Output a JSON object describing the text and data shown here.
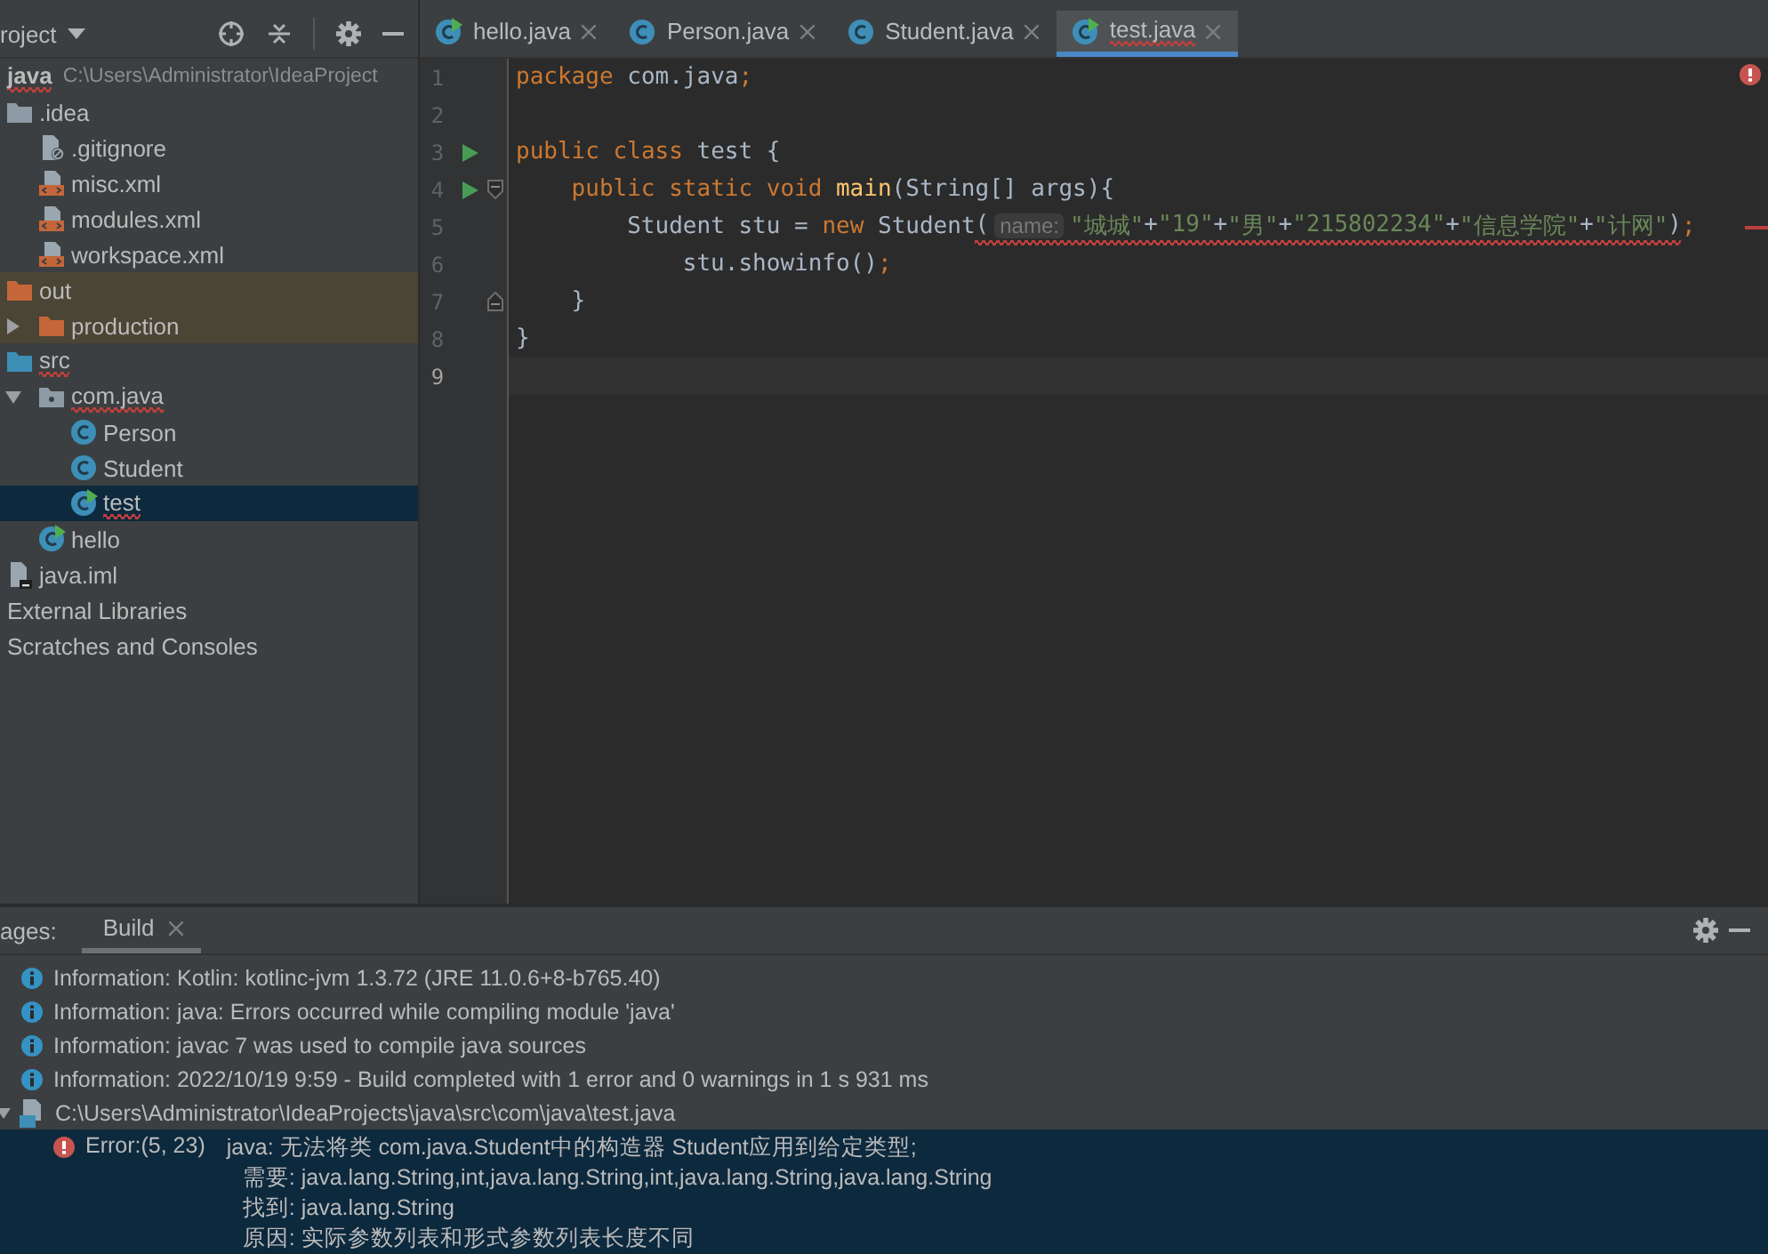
{
  "project_panel": {
    "title": "roject",
    "tree": [
      {
        "label": "java",
        "kind": "module",
        "error": true,
        "path": "C:\\Users\\Administrator\\IdeaProject",
        "selected": false,
        "children": [
          {
            "label": ".idea",
            "kind": "folder",
            "error": false,
            "selected": false,
            "children": [
              {
                "label": ".gitignore",
                "kind": "ignore-file",
                "error": false,
                "selected": false
              },
              {
                "label": "misc.xml",
                "kind": "xml-file",
                "error": false,
                "selected": false
              },
              {
                "label": "modules.xml",
                "kind": "xml-file",
                "error": false,
                "selected": false
              },
              {
                "label": "workspace.xml",
                "kind": "xml-file",
                "error": false,
                "selected": false
              }
            ]
          },
          {
            "label": "out",
            "kind": "excluded-folder",
            "error": false,
            "selected": false,
            "children": [
              {
                "label": "production",
                "kind": "excluded-folder",
                "error": false,
                "selected": false,
                "expanded": false
              }
            ]
          },
          {
            "label": "src",
            "kind": "source-folder",
            "error": true,
            "selected": false,
            "children": [
              {
                "label": "com.java",
                "kind": "package",
                "error": true,
                "selected": false,
                "expanded": true,
                "children": [
                  {
                    "label": "Person",
                    "kind": "class",
                    "error": false,
                    "selected": false
                  },
                  {
                    "label": "Student",
                    "kind": "class",
                    "error": false,
                    "selected": false
                  },
                  {
                    "label": "test",
                    "kind": "runnable-class",
                    "error": true,
                    "selected": true
                  }
                ]
              },
              {
                "label": "hello",
                "kind": "runnable-class",
                "error": false,
                "selected": false
              }
            ]
          },
          {
            "label": "java.iml",
            "kind": "module-file",
            "error": false,
            "selected": false
          }
        ]
      },
      {
        "label": "External Libraries",
        "kind": "libraries",
        "error": false,
        "selected": false
      },
      {
        "label": "Scratches and Consoles",
        "kind": "scratches",
        "error": false,
        "selected": false
      }
    ]
  },
  "editor_tabs": [
    {
      "label": "hello.java",
      "kind": "runnable-class",
      "error": false,
      "selected": false
    },
    {
      "label": "Person.java",
      "kind": "class",
      "error": false,
      "selected": false
    },
    {
      "label": "Student.java",
      "kind": "class",
      "error": false,
      "selected": false
    },
    {
      "label": "test.java",
      "kind": "runnable-class",
      "error": true,
      "selected": true
    }
  ],
  "editor": {
    "has_errors": true,
    "lines": [
      {
        "number": "1",
        "run": false,
        "fold_start": false,
        "fold_end": false,
        "current": false,
        "segments": [
          {
            "error": false,
            "tokens": [
              {
                "kind": "keyword",
                "text": "package"
              },
              {
                "kind": "plain",
                "text": " com.java"
              },
              {
                "kind": "keyword",
                "text": ";"
              }
            ]
          }
        ]
      },
      {
        "number": "2",
        "run": false,
        "fold_start": false,
        "fold_end": false,
        "current": false
      },
      {
        "number": "3",
        "run": true,
        "fold_start": false,
        "fold_end": false,
        "current": false,
        "segments": [
          {
            "error": false,
            "tokens": [
              {
                "kind": "keyword",
                "text": "public class"
              },
              {
                "kind": "plain",
                "text": " test {"
              }
            ]
          }
        ],
        "children": [
          {
            "number": "4",
            "run": true,
            "fold_start": true,
            "fold_end": false,
            "current": false,
            "segments": [
              {
                "error": false,
                "tokens": [
                  {
                    "kind": "keyword",
                    "text": "public static void"
                  },
                  {
                    "kind": "method",
                    "text": "main"
                  },
                  {
                    "kind": "plain",
                    "text": "(String[] args){"
                  }
                ]
              }
            ],
            "children": [
              {
                "number": "5",
                "run": false,
                "fold_start": false,
                "fold_end": false,
                "current": false,
                "stripe_error": true,
                "segments": [
                  {
                    "error": false,
                    "tokens": [
                      {
                        "kind": "plain",
                        "text": "Student stu = "
                      },
                      {
                        "kind": "keyword",
                        "text": "new"
                      },
                      {
                        "kind": "plain",
                        "text": " Student"
                      }
                    ]
                  },
                  {
                    "error": true,
                    "tokens": [
                      {
                        "kind": "plain",
                        "text": "("
                      },
                      {
                        "kind": "hint",
                        "text": "name:"
                      },
                      {
                        "kind": "string",
                        "text": "\"城城\""
                      },
                      {
                        "kind": "plain",
                        "text": "+"
                      },
                      {
                        "kind": "string",
                        "text": "\"19\""
                      },
                      {
                        "kind": "plain",
                        "text": "+"
                      },
                      {
                        "kind": "string",
                        "text": "\"男\""
                      },
                      {
                        "kind": "plain",
                        "text": "+"
                      },
                      {
                        "kind": "string",
                        "text": "\"215802234\""
                      },
                      {
                        "kind": "plain",
                        "text": "+"
                      },
                      {
                        "kind": "string",
                        "text": "\"信息学院\""
                      },
                      {
                        "kind": "plain",
                        "text": "+"
                      },
                      {
                        "kind": "string",
                        "text": "\"计网\""
                      },
                      {
                        "kind": "plain",
                        "text": ")"
                      }
                    ]
                  },
                  {
                    "error": false,
                    "tokens": [
                      {
                        "kind": "keyword",
                        "text": ";"
                      }
                    ]
                  }
                ],
                "children": [
                  {
                    "number": "6",
                    "run": false,
                    "fold_start": false,
                    "fold_end": false,
                    "current": false,
                    "segments": [
                      {
                        "error": false,
                        "tokens": [
                          {
                            "kind": "plain",
                            "text": "stu.showinfo()"
                          },
                          {
                            "kind": "keyword",
                            "text": ";"
                          }
                        ]
                      }
                    ]
                  }
                ]
              }
            ]
          },
          {
            "number": "7",
            "run": false,
            "fold_start": false,
            "fold_end": true,
            "current": false,
            "segments": [
              {
                "error": false,
                "tokens": [
                  {
                    "kind": "plain",
                    "text": "}"
                  }
                ]
              }
            ]
          }
        ]
      },
      {
        "number": "8",
        "run": false,
        "fold_start": false,
        "fold_end": false,
        "current": false,
        "segments": [
          {
            "error": false,
            "tokens": [
              {
                "kind": "plain",
                "text": "}"
              }
            ]
          }
        ]
      },
      {
        "number": "9",
        "run": false,
        "fold_start": false,
        "fold_end": false,
        "current": true
      }
    ]
  },
  "bottom_panel": {
    "label": "ages:",
    "tabs": [
      {
        "label": "Build",
        "selected": true
      }
    ],
    "messages": [
      {
        "kind": "info",
        "selected": false,
        "text": "Information: Kotlin: kotlinc-jvm 1.3.72 (JRE 11.0.6+8-b765.40)"
      },
      {
        "kind": "info",
        "selected": false,
        "text": "Information: java: Errors occurred while compiling module 'java'"
      },
      {
        "kind": "info",
        "selected": false,
        "text": "Information: javac 7 was used to compile java sources"
      },
      {
        "kind": "info",
        "selected": false,
        "text": "Information: 2022/10/19 9:59 - Build completed with 1 error and 0 warnings in 1 s 931 ms"
      },
      {
        "kind": "file",
        "selected": false,
        "expanded": true,
        "text": "C:\\Users\\Administrator\\IdeaProjects\\java\\src\\com\\java\\test.java"
      },
      {
        "kind": "error",
        "selected": true,
        "location": "Error:(5, 23)",
        "lines": [
          "java: 无法将类 com.java.Student中的构造器 Student应用到给定类型;",
          "需要: java.lang.String,int,java.lang.String,int,java.lang.String,java.lang.String",
          "找到: java.lang.String",
          "原因: 实际参数列表和形式参数列表长度不同"
        ]
      }
    ]
  }
}
